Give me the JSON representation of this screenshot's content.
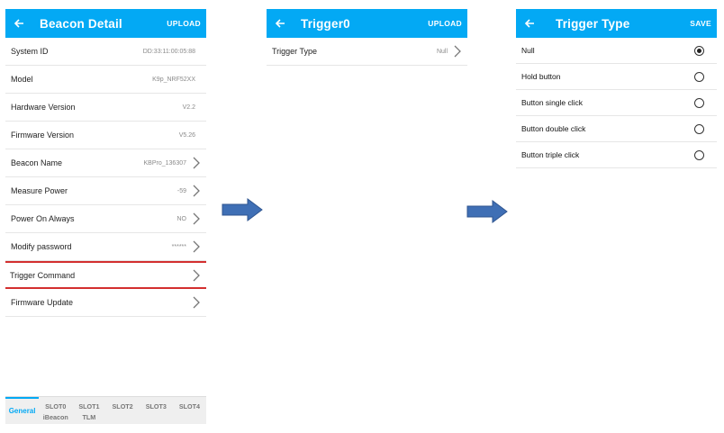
{
  "screen1": {
    "title": "Beacon Detail",
    "action": "UPLOAD",
    "rows": [
      {
        "label": "System ID",
        "value": "DD:33:11:00:05:88"
      },
      {
        "label": "Model",
        "value": "K9p_NRF52XX"
      },
      {
        "label": "Hardware Version",
        "value": "V2.2"
      },
      {
        "label": "Firmware Version",
        "value": "V5.26"
      },
      {
        "label": "Beacon Name",
        "value": "KBPro_136307"
      },
      {
        "label": "Measure Power",
        "value": "-59"
      },
      {
        "label": "Power On Always",
        "value": "NO"
      },
      {
        "label": "Modify password",
        "value": "******"
      },
      {
        "label": "Trigger Command",
        "value": ""
      },
      {
        "label": "Firmware Update",
        "value": ""
      }
    ],
    "tabs": [
      {
        "line1": "General",
        "line2": ""
      },
      {
        "line1": "SLOT0",
        "line2": "iBeacon"
      },
      {
        "line1": "SLOT1",
        "line2": "TLM"
      },
      {
        "line1": "SLOT2",
        "line2": ""
      },
      {
        "line1": "SLOT3",
        "line2": ""
      },
      {
        "line1": "SLOT4",
        "line2": ""
      }
    ]
  },
  "screen2": {
    "title": "Trigger0",
    "action": "UPLOAD",
    "rows": [
      {
        "label": "Trigger Type",
        "value": "Null"
      }
    ]
  },
  "screen3": {
    "title": "Trigger Type",
    "action": "SAVE",
    "options": [
      {
        "label": "Null",
        "selected": true
      },
      {
        "label": "Hold button",
        "selected": false
      },
      {
        "label": "Button single click",
        "selected": false
      },
      {
        "label": "Button double click",
        "selected": false
      },
      {
        "label": "Button triple click",
        "selected": false
      }
    ]
  },
  "colors": {
    "appbar": "#03a9f4",
    "highlight": "#d32f2f",
    "arrow": "#3f6fb5"
  },
  "icons": {
    "back": "arrow-left-icon",
    "chevron": "chevron-right-icon",
    "flow": "right-arrow-icon"
  }
}
